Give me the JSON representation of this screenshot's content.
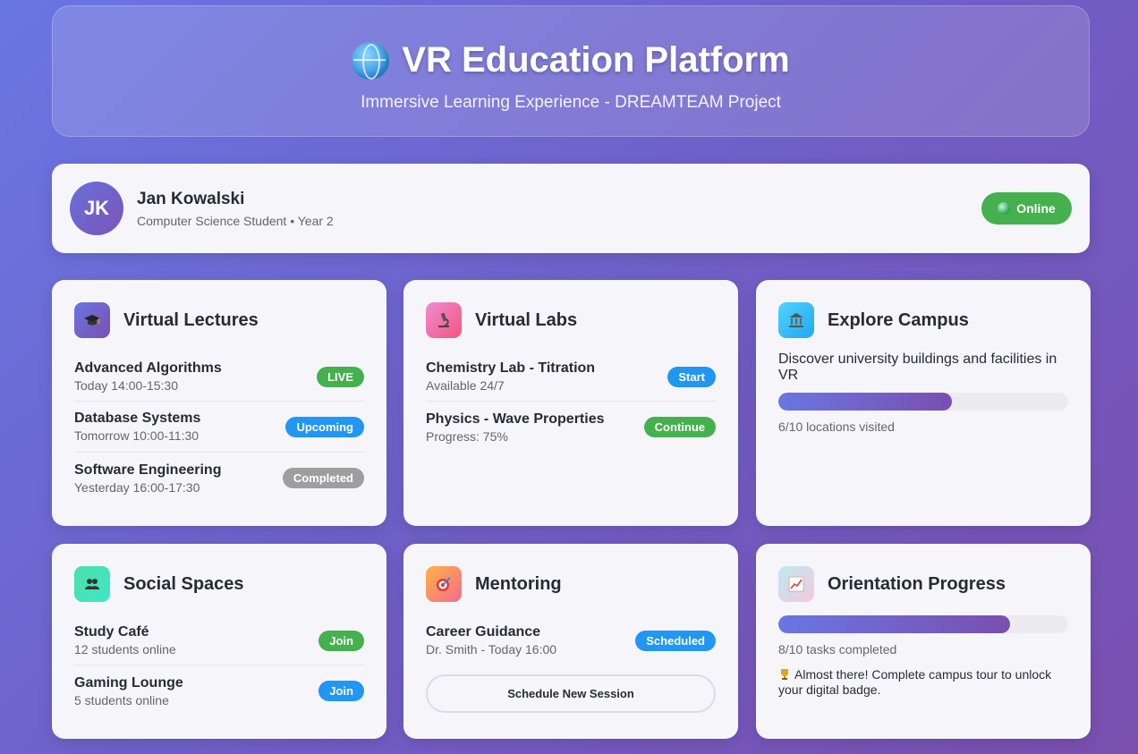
{
  "header": {
    "icon": "globe-icon",
    "title": "VR Education Platform",
    "subtitle": "Immersive Learning Experience - DREAMTEAM Project"
  },
  "profile": {
    "initials": "JK",
    "name": "Jan Kowalski",
    "subtitle": "Computer Science Student • Year 2",
    "status": "Online",
    "status_color": "#45b04e"
  },
  "lectures": {
    "icon": "graduation-cap-icon",
    "title": "Virtual Lectures",
    "items": [
      {
        "title": "Advanced Algorithms",
        "sub": "Today 14:00-15:30",
        "badge": "LIVE"
      },
      {
        "title": "Database Systems",
        "sub": "Tomorrow 10:00-11:30",
        "badge": "Upcoming"
      },
      {
        "title": "Software Engineering",
        "sub": "Yesterday 16:00-17:30",
        "badge": "Completed"
      }
    ]
  },
  "labs": {
    "icon": "microscope-icon",
    "title": "Virtual Labs",
    "items": [
      {
        "title": "Chemistry Lab - Titration",
        "sub": "Available 24/7",
        "badge": "Start"
      },
      {
        "title": "Physics - Wave Properties",
        "sub": "Progress: 75%",
        "badge": "Continue"
      }
    ]
  },
  "campus": {
    "icon": "building-icon",
    "title": "Explore Campus",
    "description": "Discover university buildings and facilities in VR",
    "progress": 0.6,
    "progress_label": "6/10 locations visited"
  },
  "social": {
    "icon": "people-icon",
    "title": "Social Spaces",
    "items": [
      {
        "title": "Study Café",
        "sub": "12 students online",
        "badge": "Join"
      },
      {
        "title": "Gaming Lounge",
        "sub": "5 students online",
        "badge": "Join"
      }
    ]
  },
  "mentoring": {
    "icon": "target-icon",
    "title": "Mentoring",
    "items": [
      {
        "title": "Career Guidance",
        "sub": "Dr. Smith - Today 16:00",
        "badge": "Scheduled"
      }
    ],
    "button": "Schedule New Session"
  },
  "orientation": {
    "icon": "chart-icon",
    "title": "Orientation Progress",
    "progress": 0.8,
    "progress_label": "8/10 tasks completed",
    "note_icon": "trophy-icon",
    "note": "Almost there! Complete campus tour to unlock your digital badge."
  },
  "colors": {
    "accent_start": "#6a76e2",
    "accent_end": "#7a4fb0",
    "green": "#45b04e",
    "blue": "#2196f3",
    "gray": "#9e9e9e"
  }
}
